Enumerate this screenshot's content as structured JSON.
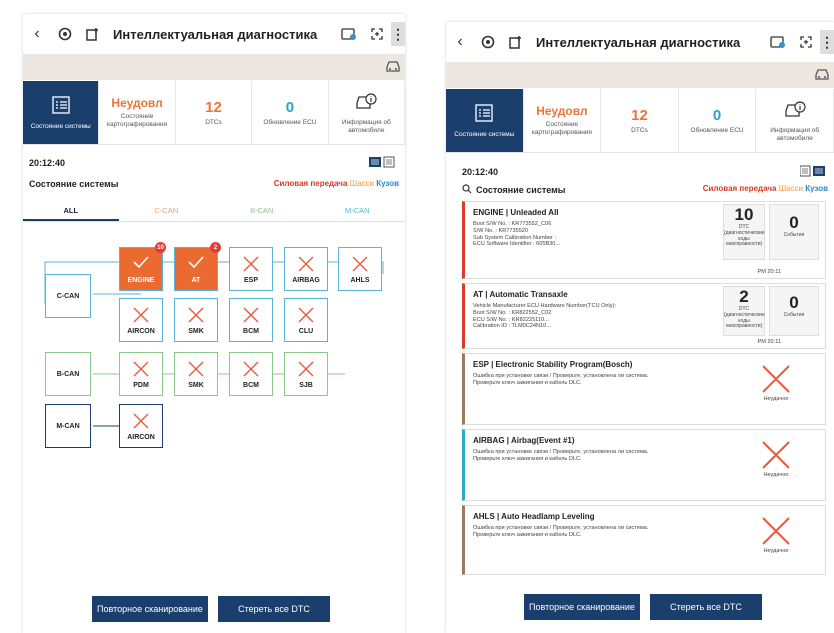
{
  "left": {
    "title": "Интеллектуальная диагностика",
    "cards": [
      {
        "big": "",
        "sm": "Состояние системы"
      },
      {
        "big": "Неудовл",
        "sm": "Состояние картографирования"
      },
      {
        "big": "12",
        "sm": "DTCs"
      },
      {
        "big": "0",
        "sm": "Обновление ECU"
      },
      {
        "big": "",
        "sm": "Информация об автомобиле"
      }
    ],
    "time": "20:12:40",
    "section": "Состояние системы",
    "links": [
      "Силовая передача",
      "Шасси",
      "Кузов"
    ],
    "tabs": [
      "ALL",
      "C-CAN",
      "B-CAN",
      "M-CAN"
    ],
    "buses": [
      "C-CAN",
      "B-CAN",
      "M-CAN"
    ],
    "nodes": {
      "engine": "ENGINE",
      "engine_badge": "10",
      "at": "AT",
      "at_badge": "2",
      "esp": "ESP",
      "airbag": "AIRBAG",
      "ahls": "AHLS",
      "aircon": "AIRCON",
      "smk": "SMK",
      "bcm": "BCM",
      "clu": "CLU",
      "pdm": "PDM",
      "smk2": "SMK",
      "bcm2": "BCM",
      "sjb": "SJB",
      "aircon2": "AIRCON"
    },
    "rescan": "Повторное сканирование",
    "erase": "Стереть все DTC"
  },
  "right": {
    "title": "Интеллектуальная диагностика",
    "cards": [
      {
        "big": "",
        "sm": "Состояние системы"
      },
      {
        "big": "Неудовл",
        "sm": "Состояние картографирования"
      },
      {
        "big": "12",
        "sm": "DTCs"
      },
      {
        "big": "0",
        "sm": "Обновление ECU"
      },
      {
        "big": "",
        "sm": "Информация об автомобиле"
      }
    ],
    "time": "20:12:40",
    "section": "Состояние системы",
    "links": [
      "Силовая передача",
      "Шасси",
      "Кузов"
    ],
    "items": [
      {
        "title": "ENGINE | Unleaded All",
        "details": [
          "Boot S/W No. : KR773552_C06",
          "S/W No. : KR7735520",
          "Sub System Calibration Number :",
          "ECU Software Identifier : 605B30..."
        ],
        "dtc": "10",
        "dtc_label": "DTC (диагностические коды неисправности)",
        "events": "0",
        "events_label": "События",
        "time": "PM 20:11"
      },
      {
        "title": "AT | Automatic Transaxle",
        "details": [
          "Vehicle Manufacturer ECU Hardware Number(TCU Only):",
          "Boot S/W No. : KR822552_C02",
          "ECU S/W No. : KR82225110...",
          "Calibration ID : TLM0C24N10..."
        ],
        "dtc": "2",
        "dtc_label": "DTC (диагностические коды неисправности)",
        "events": "0",
        "events_label": "События",
        "time": "PM 20:11"
      },
      {
        "title": "ESP | Electronic Stability Program(Bosch)",
        "details": [
          "Ошибка при установке связи / Проверьте, установлена ли система.",
          "Проверьте ключ зажигания и кабель DLC."
        ],
        "status": "Неудачно"
      },
      {
        "title": "AIRBAG | Airbag(Event #1)",
        "details": [
          "Ошибка при установке связи / Проверьте, установлена ли система.",
          "Проверьте ключ зажигания и кабель DLC."
        ],
        "status": "Неудачно"
      },
      {
        "title": "AHLS | Auto Headlamp Leveling",
        "details": [
          "Ошибка при установке связи / Проверьте, установлена ли система.",
          "Проверьте ключ зажигания и кабель DLC."
        ],
        "status": "Неудачно"
      }
    ],
    "rescan": "Повторное сканирование",
    "erase": "Стереть все DTC"
  },
  "colors": {
    "navy": "#1b3f6c",
    "orange": "#e8763a",
    "error": "#ea6a32",
    "ccan": "#5ab4d3",
    "bcan": "#8ac98a"
  },
  "icons": [
    "back-arrow-icon",
    "scan-settings-icon",
    "vehicle-connect-icon",
    "vci-icon",
    "fullscreen-icon",
    "more-icon",
    "car-icon",
    "list-icon",
    "car-info-icon",
    "grid-view-icon",
    "search-icon",
    "error-x-icon",
    "check-icon"
  ]
}
